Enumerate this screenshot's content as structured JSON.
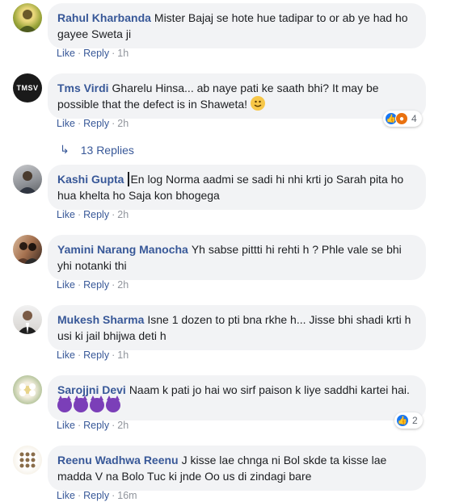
{
  "comments": [
    {
      "author": "Rahul Kharbanda",
      "text": "Mister Bajaj se hote hue tadipar to or ab ye had ho gayee Sweta ji",
      "like": "Like",
      "reply": "Reply",
      "time": "1h"
    },
    {
      "author": "Tms Virdi",
      "avatar_text": "TMSV",
      "text": "Gharelu Hinsa... ab naye pati ke saath bhi? It may be possible that the defect is in Shaweta!",
      "emoji": "smile-emoji",
      "like": "Like",
      "reply": "Reply",
      "time": "2h",
      "reaction_count": "4",
      "replies_label": "13 Replies"
    },
    {
      "author": "Kashi Gupta",
      "text": "En log Norma aadmi se sadi hi nhi krti jo Sarah pita ho hua khelta ho Saja kon bhogega",
      "like": "Like",
      "reply": "Reply",
      "time": "2h"
    },
    {
      "author": "Yamini Narang Manocha",
      "text": "Yh sabse pittti hi rehti h ? Phle vale se bhi yhi notanki thi",
      "like": "Like",
      "reply": "Reply",
      "time": "2h"
    },
    {
      "author": "Mukesh Sharma",
      "text": "Isne 1 dozen to pti bna rkhe h... Jisse bhi shadi krti h usi ki jail bhijwa deti h",
      "like": "Like",
      "reply": "Reply",
      "time": "1h"
    },
    {
      "author": "Sarojjni Devi",
      "text": "Naam k pati jo hai wo sirf paison k liye saddhi kartei hai.",
      "emoji": "devil-emoji",
      "like": "Like",
      "reply": "Reply",
      "time": "2h",
      "reaction_count": "2"
    },
    {
      "author": "Reenu Wadhwa Reenu",
      "text": "J kisse lae chnga ni Bol skde ta kisse lae madda V na Bolo Tuc ki jnde Oo us di zindagi bare",
      "like": "Like",
      "reply": "Reply",
      "time": "16m"
    }
  ],
  "colors": {
    "author": "#385898",
    "bubble": "#f2f3f5",
    "like_reaction": "#1877f2",
    "angry_reaction": "#e9710f"
  }
}
